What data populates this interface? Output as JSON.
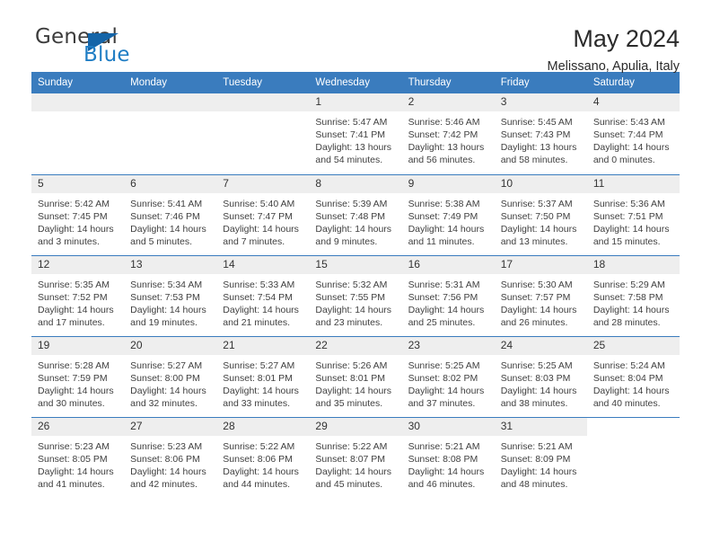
{
  "brand": {
    "name_part1": "General",
    "name_part2": "Blue",
    "triangle_color": "#1565a8",
    "blue_color": "#1f7dc4"
  },
  "header": {
    "title": "May 2024",
    "subtitle": "Melissano, Apulia, Italy"
  },
  "theme": {
    "header_bg": "#3a7cbe",
    "daynum_bg": "#eeeeee",
    "text": "#2b2b2b"
  },
  "weekday_headers": [
    "Sunday",
    "Monday",
    "Tuesday",
    "Wednesday",
    "Thursday",
    "Friday",
    "Saturday"
  ],
  "weeks": [
    [
      {
        "day": "",
        "lines": []
      },
      {
        "day": "",
        "lines": []
      },
      {
        "day": "",
        "lines": []
      },
      {
        "day": "1",
        "lines": [
          "Sunrise: 5:47 AM",
          "Sunset: 7:41 PM",
          "Daylight: 13 hours",
          "and 54 minutes."
        ]
      },
      {
        "day": "2",
        "lines": [
          "Sunrise: 5:46 AM",
          "Sunset: 7:42 PM",
          "Daylight: 13 hours",
          "and 56 minutes."
        ]
      },
      {
        "day": "3",
        "lines": [
          "Sunrise: 5:45 AM",
          "Sunset: 7:43 PM",
          "Daylight: 13 hours",
          "and 58 minutes."
        ]
      },
      {
        "day": "4",
        "lines": [
          "Sunrise: 5:43 AM",
          "Sunset: 7:44 PM",
          "Daylight: 14 hours",
          "and 0 minutes."
        ]
      }
    ],
    [
      {
        "day": "5",
        "lines": [
          "Sunrise: 5:42 AM",
          "Sunset: 7:45 PM",
          "Daylight: 14 hours",
          "and 3 minutes."
        ]
      },
      {
        "day": "6",
        "lines": [
          "Sunrise: 5:41 AM",
          "Sunset: 7:46 PM",
          "Daylight: 14 hours",
          "and 5 minutes."
        ]
      },
      {
        "day": "7",
        "lines": [
          "Sunrise: 5:40 AM",
          "Sunset: 7:47 PM",
          "Daylight: 14 hours",
          "and 7 minutes."
        ]
      },
      {
        "day": "8",
        "lines": [
          "Sunrise: 5:39 AM",
          "Sunset: 7:48 PM",
          "Daylight: 14 hours",
          "and 9 minutes."
        ]
      },
      {
        "day": "9",
        "lines": [
          "Sunrise: 5:38 AM",
          "Sunset: 7:49 PM",
          "Daylight: 14 hours",
          "and 11 minutes."
        ]
      },
      {
        "day": "10",
        "lines": [
          "Sunrise: 5:37 AM",
          "Sunset: 7:50 PM",
          "Daylight: 14 hours",
          "and 13 minutes."
        ]
      },
      {
        "day": "11",
        "lines": [
          "Sunrise: 5:36 AM",
          "Sunset: 7:51 PM",
          "Daylight: 14 hours",
          "and 15 minutes."
        ]
      }
    ],
    [
      {
        "day": "12",
        "lines": [
          "Sunrise: 5:35 AM",
          "Sunset: 7:52 PM",
          "Daylight: 14 hours",
          "and 17 minutes."
        ]
      },
      {
        "day": "13",
        "lines": [
          "Sunrise: 5:34 AM",
          "Sunset: 7:53 PM",
          "Daylight: 14 hours",
          "and 19 minutes."
        ]
      },
      {
        "day": "14",
        "lines": [
          "Sunrise: 5:33 AM",
          "Sunset: 7:54 PM",
          "Daylight: 14 hours",
          "and 21 minutes."
        ]
      },
      {
        "day": "15",
        "lines": [
          "Sunrise: 5:32 AM",
          "Sunset: 7:55 PM",
          "Daylight: 14 hours",
          "and 23 minutes."
        ]
      },
      {
        "day": "16",
        "lines": [
          "Sunrise: 5:31 AM",
          "Sunset: 7:56 PM",
          "Daylight: 14 hours",
          "and 25 minutes."
        ]
      },
      {
        "day": "17",
        "lines": [
          "Sunrise: 5:30 AM",
          "Sunset: 7:57 PM",
          "Daylight: 14 hours",
          "and 26 minutes."
        ]
      },
      {
        "day": "18",
        "lines": [
          "Sunrise: 5:29 AM",
          "Sunset: 7:58 PM",
          "Daylight: 14 hours",
          "and 28 minutes."
        ]
      }
    ],
    [
      {
        "day": "19",
        "lines": [
          "Sunrise: 5:28 AM",
          "Sunset: 7:59 PM",
          "Daylight: 14 hours",
          "and 30 minutes."
        ]
      },
      {
        "day": "20",
        "lines": [
          "Sunrise: 5:27 AM",
          "Sunset: 8:00 PM",
          "Daylight: 14 hours",
          "and 32 minutes."
        ]
      },
      {
        "day": "21",
        "lines": [
          "Sunrise: 5:27 AM",
          "Sunset: 8:01 PM",
          "Daylight: 14 hours",
          "and 33 minutes."
        ]
      },
      {
        "day": "22",
        "lines": [
          "Sunrise: 5:26 AM",
          "Sunset: 8:01 PM",
          "Daylight: 14 hours",
          "and 35 minutes."
        ]
      },
      {
        "day": "23",
        "lines": [
          "Sunrise: 5:25 AM",
          "Sunset: 8:02 PM",
          "Daylight: 14 hours",
          "and 37 minutes."
        ]
      },
      {
        "day": "24",
        "lines": [
          "Sunrise: 5:25 AM",
          "Sunset: 8:03 PM",
          "Daylight: 14 hours",
          "and 38 minutes."
        ]
      },
      {
        "day": "25",
        "lines": [
          "Sunrise: 5:24 AM",
          "Sunset: 8:04 PM",
          "Daylight: 14 hours",
          "and 40 minutes."
        ]
      }
    ],
    [
      {
        "day": "26",
        "lines": [
          "Sunrise: 5:23 AM",
          "Sunset: 8:05 PM",
          "Daylight: 14 hours",
          "and 41 minutes."
        ]
      },
      {
        "day": "27",
        "lines": [
          "Sunrise: 5:23 AM",
          "Sunset: 8:06 PM",
          "Daylight: 14 hours",
          "and 42 minutes."
        ]
      },
      {
        "day": "28",
        "lines": [
          "Sunrise: 5:22 AM",
          "Sunset: 8:06 PM",
          "Daylight: 14 hours",
          "and 44 minutes."
        ]
      },
      {
        "day": "29",
        "lines": [
          "Sunrise: 5:22 AM",
          "Sunset: 8:07 PM",
          "Daylight: 14 hours",
          "and 45 minutes."
        ]
      },
      {
        "day": "30",
        "lines": [
          "Sunrise: 5:21 AM",
          "Sunset: 8:08 PM",
          "Daylight: 14 hours",
          "and 46 minutes."
        ]
      },
      {
        "day": "31",
        "lines": [
          "Sunrise: 5:21 AM",
          "Sunset: 8:09 PM",
          "Daylight: 14 hours",
          "and 48 minutes."
        ]
      },
      {
        "day": "",
        "lines": []
      }
    ]
  ]
}
